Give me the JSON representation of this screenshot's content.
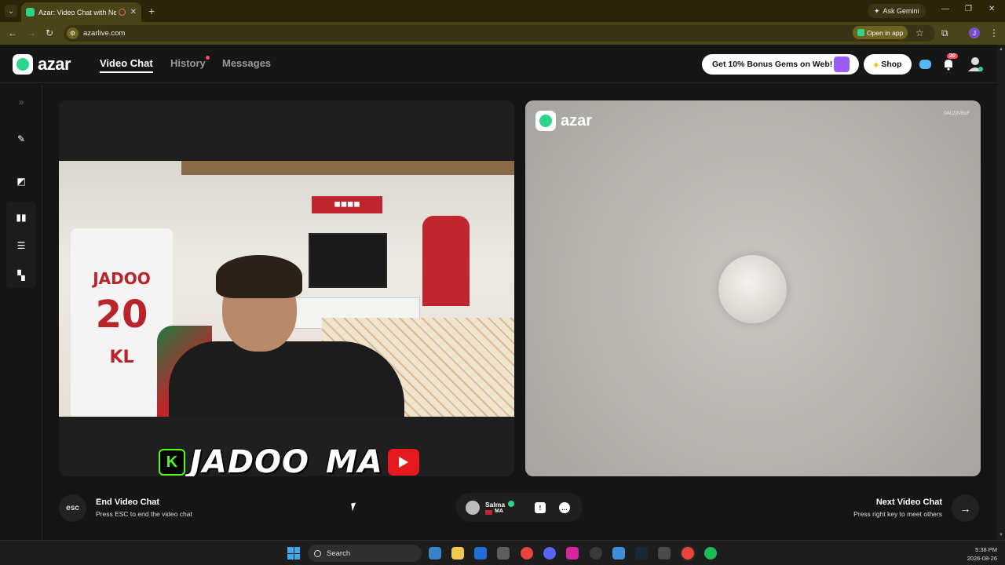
{
  "browser": {
    "tab_title": "Azar: Video Chat with New",
    "ask_gemini": "Ask Gemini",
    "url": "azarlive.com",
    "open_in_app": "Open in app",
    "profile_initial": "J"
  },
  "header": {
    "logo_text": "azar",
    "nav": [
      "Video Chat",
      "History",
      "Messages"
    ],
    "promo": "Get 10% Bonus Gems on Web!",
    "shop": "Shop",
    "notification_count": "20"
  },
  "left_video": {
    "jersey_name": "JADOO",
    "jersey_number": "20",
    "jersey_initials": "KL",
    "streamer_handle": "JADOO_MA",
    "kick_logo": "K"
  },
  "right_video": {
    "logo_text": "azar",
    "watermark": "0AL2}fVBuF"
  },
  "controls": {
    "esc_label": "esc",
    "end_title": "End Video Chat",
    "end_sub": "Press ESC to end the video chat",
    "partner_name": "Salma",
    "partner_country": "MA",
    "next_title": "Next Video Chat",
    "next_sub": "Press right key to meet others"
  },
  "taskbar": {
    "search": "Search",
    "time": "5:38 PM",
    "date": "2026-08-26"
  },
  "colors": {
    "brand_green": "#2fd48b",
    "chrome_bg": "#4a4419",
    "app_bg": "#151515"
  }
}
